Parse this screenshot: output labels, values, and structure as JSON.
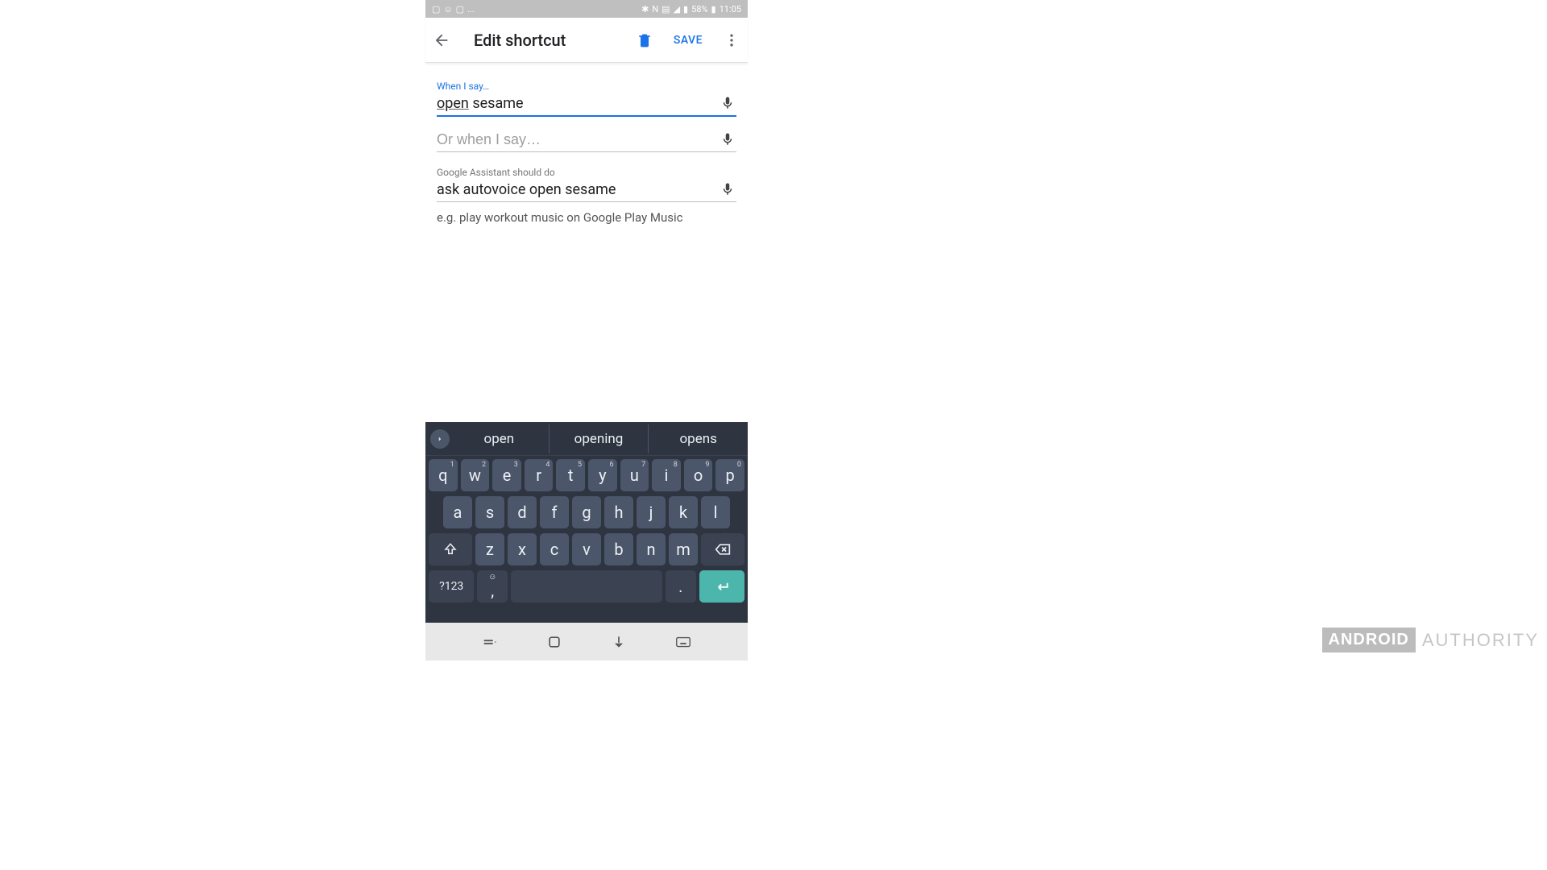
{
  "status_bar": {
    "battery": "58%",
    "time": "11:05",
    "left_dots": "..."
  },
  "header": {
    "title": "Edit shortcut",
    "save_label": "SAVE"
  },
  "fields": {
    "trigger_label": "When I say…",
    "trigger_word_underlined": "open",
    "trigger_word_rest": " sesame",
    "alt_placeholder": "Or when I say…",
    "action_label": "Google Assistant should do",
    "action_value": "ask autovoice open sesame",
    "helper": "e.g. play workout music on Google Play Music"
  },
  "keyboard": {
    "suggestions": [
      "open",
      "opening",
      "opens"
    ],
    "row1": [
      {
        "k": "q",
        "h": "1"
      },
      {
        "k": "w",
        "h": "2"
      },
      {
        "k": "e",
        "h": "3"
      },
      {
        "k": "r",
        "h": "4"
      },
      {
        "k": "t",
        "h": "5"
      },
      {
        "k": "y",
        "h": "6"
      },
      {
        "k": "u",
        "h": "7"
      },
      {
        "k": "i",
        "h": "8"
      },
      {
        "k": "o",
        "h": "9"
      },
      {
        "k": "p",
        "h": "0"
      }
    ],
    "row2": [
      "a",
      "s",
      "d",
      "f",
      "g",
      "h",
      "j",
      "k",
      "l"
    ],
    "row3": [
      "z",
      "x",
      "c",
      "v",
      "b",
      "n",
      "m"
    ],
    "numkey": "?123",
    "comma": ",",
    "period": "."
  },
  "watermark": {
    "brand": "ANDROID",
    "sub": "AUTHORITY"
  }
}
